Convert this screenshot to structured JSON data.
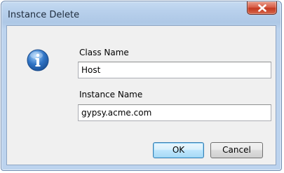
{
  "window": {
    "title": "Instance Delete"
  },
  "form": {
    "class_name_label": "Class Name",
    "class_name_value": "Host",
    "instance_name_label": "Instance Name",
    "instance_name_value": "gypsy.acme.com"
  },
  "buttons": {
    "ok_label": "OK",
    "cancel_label": "Cancel"
  },
  "icons": {
    "dialog_icon": "information-icon",
    "close_icon": "close-icon"
  },
  "colors": {
    "close_button": "#c43a22",
    "info_icon": "#2f73c4"
  }
}
